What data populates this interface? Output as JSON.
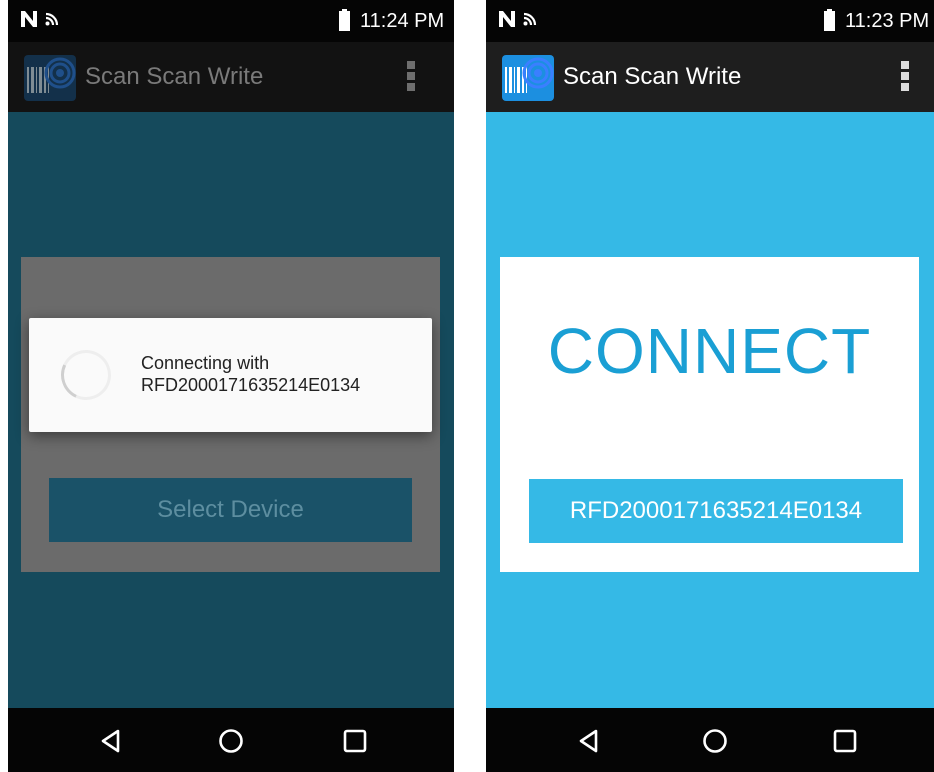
{
  "app": {
    "title": "Scan Scan Write"
  },
  "left_screen": {
    "status_time": "11:24 PM",
    "dialog": {
      "line1": "Connecting with",
      "line2": "RFD2000171635214E0134"
    },
    "select_device_label": "Select Device"
  },
  "right_screen": {
    "status_time": "11:23 PM",
    "connect_title": "CONNECT",
    "device_button_label": "RFD2000171635214E0134"
  },
  "icons": {
    "status_left": [
      "nfc-icon",
      "wifi-icon"
    ],
    "status_right": [
      "battery-icon"
    ],
    "app": "barcode-scanner-app-icon",
    "menu": "overflow-menu-icon",
    "nav": [
      "back-icon",
      "home-icon",
      "recents-icon"
    ]
  },
  "colors": {
    "left_background_dim": "#154a5c",
    "left_actionbar_dim": "#121212",
    "left_card_dim": "#6b6b6b",
    "left_button_dim": "#1a5268",
    "right_background": "#35b9e6",
    "right_actionbar": "#1e1e1e",
    "connect_text": "#1a9fd4",
    "device_button": "#35b9e6",
    "status_bar": "#050505",
    "nav_bar": "#050505"
  }
}
